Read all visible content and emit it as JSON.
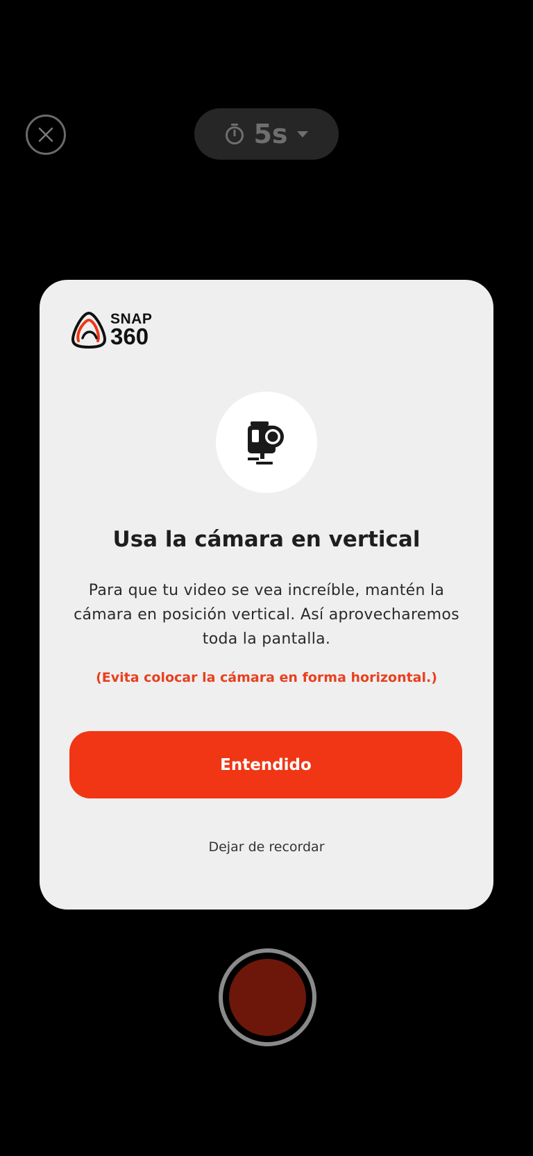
{
  "top_bar": {
    "close_icon": "close-icon",
    "timer_icon": "stopwatch-icon",
    "timer_value": "5s",
    "dropdown_icon": "caret-down-icon"
  },
  "modal": {
    "logo": {
      "line1": "SNAP",
      "line2": "360"
    },
    "illustration_icon": "action-camera-icon",
    "title": "Usa la cámara en vertical",
    "body": "Para que tu video se vea increíble, mantén la cámara en posición vertical. Así aprovecharemos toda la pantalla.",
    "warning": "(Evita colocar la cámara en forma horizontal.)",
    "primary_button": "Entendido",
    "secondary_link": "Dejar de recordar"
  },
  "record_button": {
    "icon": "record-button"
  },
  "colors": {
    "accent": "#f03614",
    "warning": "#e8401f",
    "modal_bg": "#efefef",
    "record_fill": "#6d170b"
  }
}
